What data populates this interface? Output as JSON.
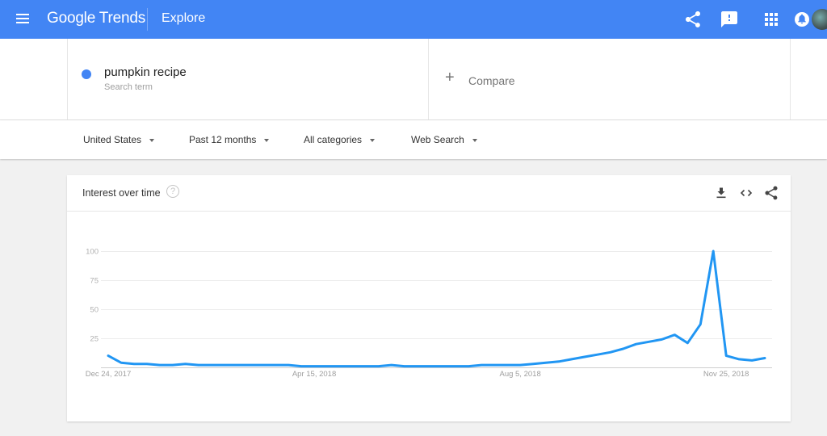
{
  "header": {
    "app_title": "Google Trends",
    "section": "Explore",
    "icons": [
      "menu-icon",
      "share-icon",
      "feedback-icon",
      "apps-icon",
      "notifications-icon",
      "avatar"
    ],
    "brand_color": "#4285f4"
  },
  "search": {
    "term": "pumpkin recipe",
    "term_subtitle": "Search term",
    "term_color": "#4285f4",
    "compare_label": "Compare"
  },
  "filters": {
    "region": "United States",
    "time_range": "Past 12 months",
    "category": "All categories",
    "search_type": "Web Search"
  },
  "card": {
    "title": "Interest over time",
    "help_icon": "?",
    "actions": [
      "download-icon",
      "embed-icon",
      "share-icon"
    ]
  },
  "chart_data": {
    "type": "line",
    "title": "Interest over time",
    "xlabel": "",
    "ylabel": "",
    "ylim": [
      0,
      100
    ],
    "yticks": [
      25,
      50,
      75,
      100
    ],
    "grid": true,
    "line_color": "#2196f3",
    "x": [
      "Dec 24, 2017",
      "Dec 31, 2017",
      "Jan 7, 2018",
      "Jan 14, 2018",
      "Jan 21, 2018",
      "Jan 28, 2018",
      "Feb 4, 2018",
      "Feb 11, 2018",
      "Feb 18, 2018",
      "Feb 25, 2018",
      "Mar 4, 2018",
      "Mar 11, 2018",
      "Mar 18, 2018",
      "Mar 25, 2018",
      "Apr 1, 2018",
      "Apr 8, 2018",
      "Apr 15, 2018",
      "Apr 22, 2018",
      "Apr 29, 2018",
      "May 6, 2018",
      "May 13, 2018",
      "May 20, 2018",
      "May 27, 2018",
      "Jun 3, 2018",
      "Jun 10, 2018",
      "Jun 17, 2018",
      "Jun 24, 2018",
      "Jul 1, 2018",
      "Jul 8, 2018",
      "Jul 15, 2018",
      "Jul 22, 2018",
      "Jul 29, 2018",
      "Aug 5, 2018",
      "Aug 12, 2018",
      "Aug 19, 2018",
      "Aug 26, 2018",
      "Sep 2, 2018",
      "Sep 9, 2018",
      "Sep 16, 2018",
      "Sep 23, 2018",
      "Sep 30, 2018",
      "Oct 7, 2018",
      "Oct 14, 2018",
      "Oct 21, 2018",
      "Oct 28, 2018",
      "Nov 4, 2018",
      "Nov 11, 2018",
      "Nov 18, 2018",
      "Nov 25, 2018",
      "Dec 2, 2018",
      "Dec 9, 2018",
      "Dec 16, 2018"
    ],
    "series": [
      {
        "name": "pumpkin recipe",
        "values": [
          10,
          4,
          3,
          3,
          2,
          2,
          3,
          2,
          2,
          2,
          2,
          2,
          2,
          2,
          2,
          1,
          1,
          1,
          1,
          1,
          1,
          1,
          2,
          1,
          1,
          1,
          1,
          1,
          1,
          2,
          2,
          2,
          2,
          3,
          4,
          5,
          7,
          9,
          11,
          13,
          16,
          20,
          22,
          24,
          28,
          21,
          37,
          100,
          10,
          7,
          6,
          8
        ]
      }
    ],
    "x_tick_labels": [
      {
        "index": 0,
        "label": "Dec 24, 2017"
      },
      {
        "index": 16,
        "label": "Apr 15, 2018"
      },
      {
        "index": 32,
        "label": "Aug 5, 2018"
      },
      {
        "index": 48,
        "label": "Nov 25, 2018"
      }
    ]
  }
}
